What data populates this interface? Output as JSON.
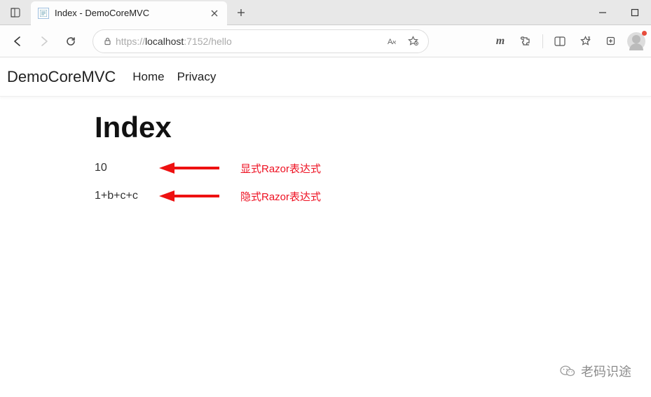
{
  "title_bar": {
    "tab_title": "Index - DemoCoreMVC"
  },
  "address_bar": {
    "url_scheme": "https://",
    "url_host": "localhost",
    "url_port_path": ":7152/hello"
  },
  "nav": {
    "brand": "DemoCoreMVC",
    "links": {
      "home": "Home",
      "privacy": "Privacy"
    }
  },
  "content": {
    "heading": "Index",
    "row1_value": "10",
    "row1_annotation": "显式Razor表达式",
    "row2_value": "1+b+c+c",
    "row2_annotation": "隐式Razor表达式"
  },
  "extensions": {
    "m_label": "m"
  },
  "watermark": {
    "text": "老码识途"
  }
}
